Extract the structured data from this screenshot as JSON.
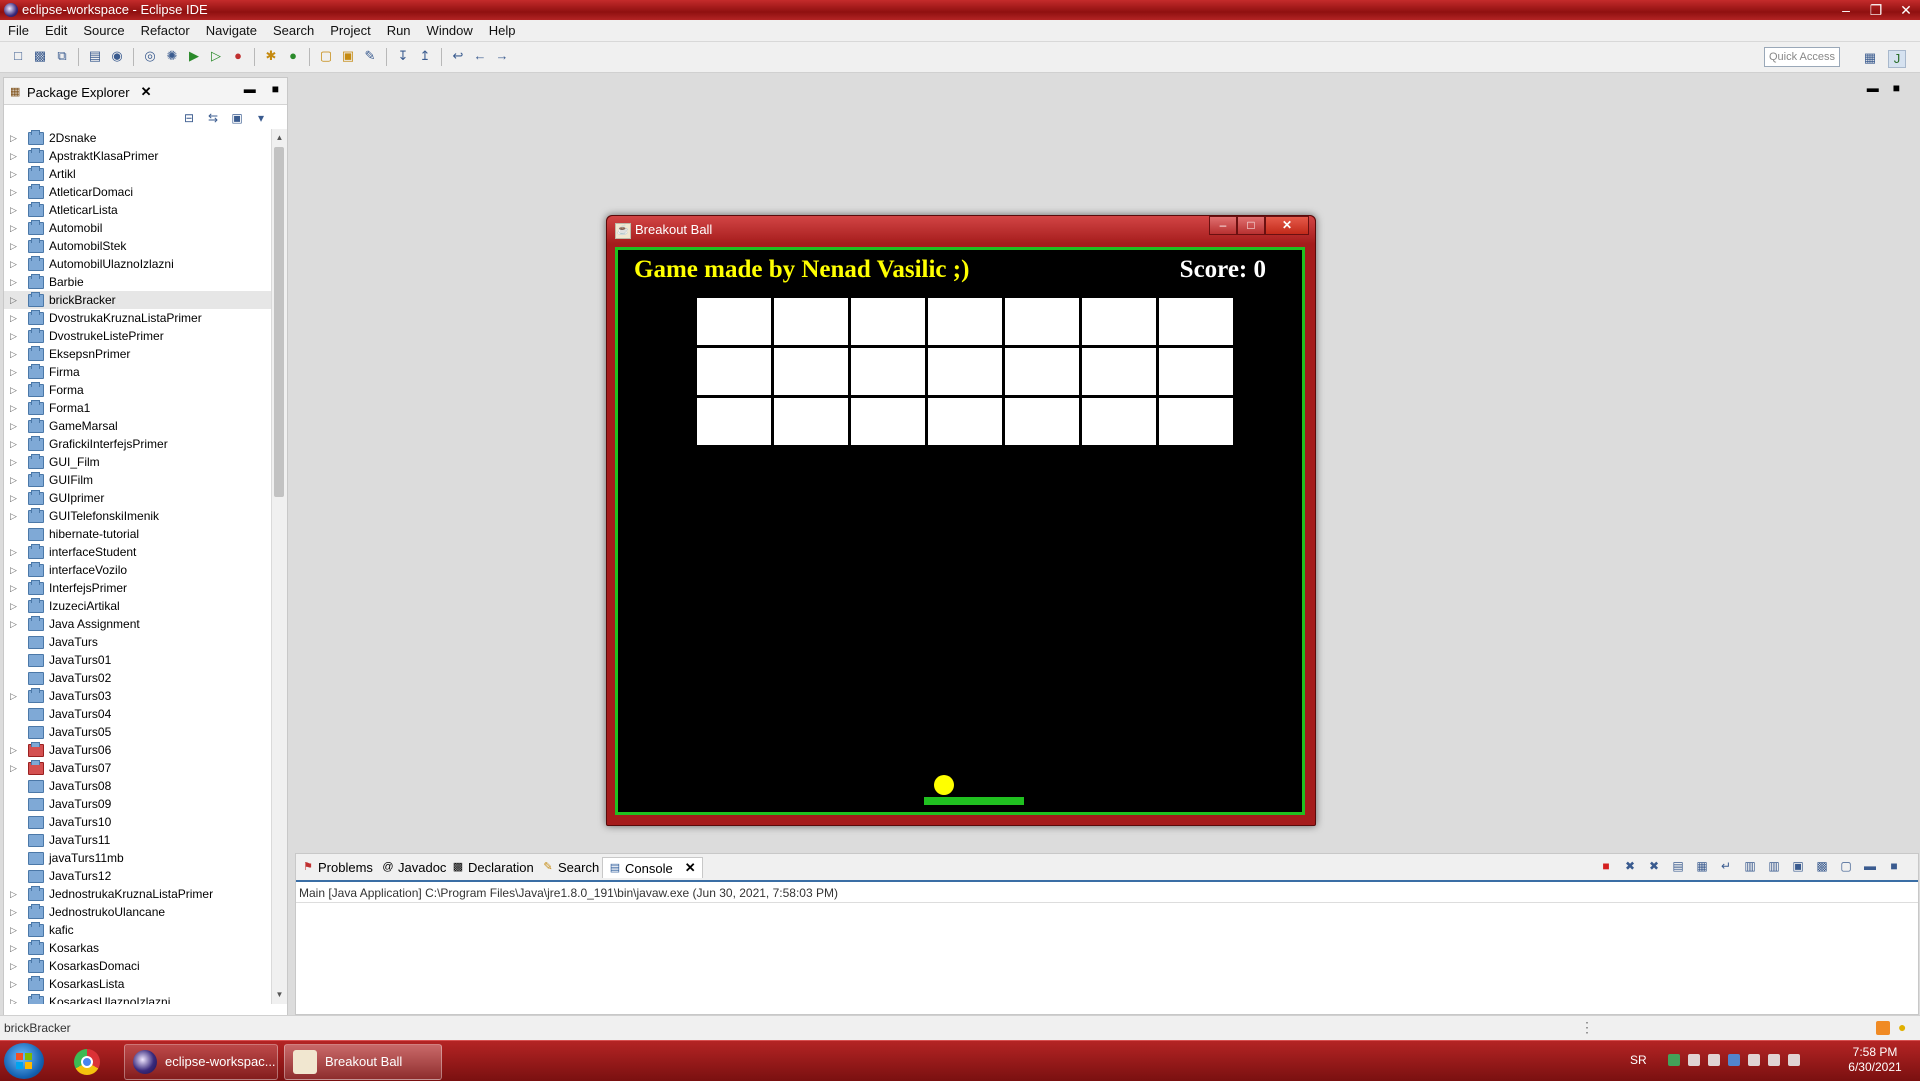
{
  "window": {
    "title": "eclipse-workspace - Eclipse IDE"
  },
  "menu": [
    "File",
    "Edit",
    "Source",
    "Refactor",
    "Navigate",
    "Search",
    "Project",
    "Run",
    "Window",
    "Help"
  ],
  "toolbar": {
    "quick_access": "Quick Access"
  },
  "package_explorer": {
    "tab_label": "Package Explorer",
    "items": [
      {
        "label": "2Dsnake",
        "expandable": true,
        "error": false
      },
      {
        "label": "ApstraktKlasaPrimer",
        "expandable": true,
        "error": false
      },
      {
        "label": "Artikl",
        "expandable": true,
        "error": false
      },
      {
        "label": "AtleticarDomaci",
        "expandable": true,
        "error": false
      },
      {
        "label": "AtleticarLista",
        "expandable": true,
        "error": false
      },
      {
        "label": "Automobil",
        "expandable": true,
        "error": false
      },
      {
        "label": "AutomobilStek",
        "expandable": true,
        "error": false
      },
      {
        "label": "AutomobilUlaznoIzlazni",
        "expandable": true,
        "error": false
      },
      {
        "label": "Barbie",
        "expandable": true,
        "error": false
      },
      {
        "label": "brickBracker",
        "expandable": true,
        "error": false,
        "selected": true
      },
      {
        "label": "DvostrukaKruznaListaPrimer",
        "expandable": true,
        "error": false
      },
      {
        "label": "DvostrukeListePrimer",
        "expandable": true,
        "error": false
      },
      {
        "label": "EksepsnPrimer",
        "expandable": true,
        "error": false
      },
      {
        "label": "Firma",
        "expandable": true,
        "error": false
      },
      {
        "label": "Forma",
        "expandable": true,
        "error": false
      },
      {
        "label": "Forma1",
        "expandable": true,
        "error": false
      },
      {
        "label": "GameMarsal",
        "expandable": true,
        "error": false
      },
      {
        "label": "GrafickiInterfejsPrimer",
        "expandable": true,
        "error": false
      },
      {
        "label": "GUI_Film",
        "expandable": true,
        "error": false
      },
      {
        "label": "GUIFilm",
        "expandable": true,
        "error": false
      },
      {
        "label": "GUIprimer",
        "expandable": true,
        "error": false
      },
      {
        "label": "GUITelefonskiImenik",
        "expandable": true,
        "error": false
      },
      {
        "label": "hibernate-tutorial",
        "expandable": false,
        "error": false
      },
      {
        "label": "interfaceStudent",
        "expandable": true,
        "error": false
      },
      {
        "label": "interfaceVozilo",
        "expandable": true,
        "error": false
      },
      {
        "label": "InterfejsPrimer",
        "expandable": true,
        "error": false
      },
      {
        "label": "IzuzeciArtikal",
        "expandable": true,
        "error": false
      },
      {
        "label": "Java Assignment",
        "expandable": true,
        "error": false
      },
      {
        "label": "JavaTurs",
        "expandable": false,
        "error": false
      },
      {
        "label": "JavaTurs01",
        "expandable": false,
        "error": false
      },
      {
        "label": "JavaTurs02",
        "expandable": false,
        "error": false
      },
      {
        "label": "JavaTurs03",
        "expandable": true,
        "error": false
      },
      {
        "label": "JavaTurs04",
        "expandable": false,
        "error": false
      },
      {
        "label": "JavaTurs05",
        "expandable": false,
        "error": false
      },
      {
        "label": "JavaTurs06",
        "expandable": true,
        "error": true
      },
      {
        "label": "JavaTurs07",
        "expandable": true,
        "error": true
      },
      {
        "label": "JavaTurs08",
        "expandable": false,
        "error": false
      },
      {
        "label": "JavaTurs09",
        "expandable": false,
        "error": false
      },
      {
        "label": "JavaTurs10",
        "expandable": false,
        "error": false
      },
      {
        "label": "JavaTurs11",
        "expandable": false,
        "error": false
      },
      {
        "label": "javaTurs11mb",
        "expandable": false,
        "error": false
      },
      {
        "label": "JavaTurs12",
        "expandable": false,
        "error": false
      },
      {
        "label": "JednostrukaKruznaListaPrimer",
        "expandable": true,
        "error": false
      },
      {
        "label": "JednostrukoUlancane",
        "expandable": true,
        "error": false
      },
      {
        "label": "kafic",
        "expandable": true,
        "error": false
      },
      {
        "label": "Kosarkas",
        "expandable": true,
        "error": false
      },
      {
        "label": "KosarkasDomaci",
        "expandable": true,
        "error": false
      },
      {
        "label": "KosarkasLista",
        "expandable": true,
        "error": false
      },
      {
        "label": "KosarkasUlaznoIzlazni",
        "expandable": true,
        "error": false
      }
    ]
  },
  "bottom_panel": {
    "tabs": [
      {
        "label": "Problems",
        "icon": "problems-icon"
      },
      {
        "label": "Javadoc",
        "icon": "javadoc-icon"
      },
      {
        "label": "Declaration",
        "icon": "declaration-icon"
      },
      {
        "label": "Search",
        "icon": "search-icon"
      },
      {
        "label": "Console",
        "icon": "console-icon",
        "active": true
      }
    ],
    "console_description": "Main [Java Application] C:\\Program Files\\Java\\jre1.8.0_191\\bin\\javaw.exe (Jun 30, 2021, 7:58:03 PM)"
  },
  "status_bar": {
    "selected_item": "brickBracker"
  },
  "game": {
    "title": "Breakout Ball",
    "author_text": "Game made by Nenad Vasilic ;)",
    "score_text": "Score: 0",
    "brick_rows": 3,
    "brick_cols": 7,
    "colors": {
      "background": "#000000",
      "border": "#20c020",
      "bricks": "#ffffff",
      "ball": "#ffff00",
      "paddle": "#20c020",
      "author_text": "#ffff00",
      "score_text": "#ffffff"
    }
  },
  "taskbar": {
    "items": [
      {
        "label": "eclipse-workspac...",
        "icon": "eclipse-icon"
      },
      {
        "label": "Breakout Ball",
        "icon": "java-icon",
        "active": true
      }
    ],
    "language": "SR",
    "time": "7:58 PM",
    "date": "6/30/2021"
  }
}
